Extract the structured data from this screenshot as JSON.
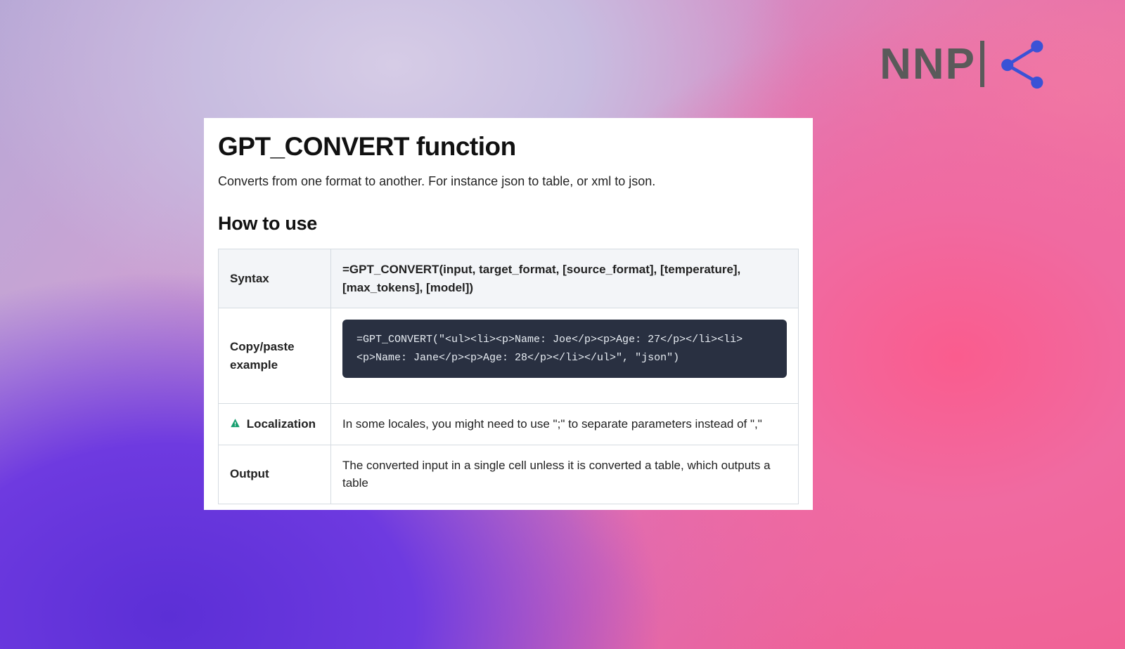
{
  "brand": {
    "text": "NNP"
  },
  "doc": {
    "title": "GPT_CONVERT function",
    "subtitle": "Converts from one format to another. For instance json to table, or xml to json.",
    "section_heading": "How to use",
    "table": {
      "syntax": {
        "label": "Syntax",
        "value": "=GPT_CONVERT(input, target_format, [source_format], [temperature], [max_tokens], [model])"
      },
      "example": {
        "label": "Copy/paste example",
        "code": "=GPT_CONVERT(\"<ul><li><p>Name: Joe</p><p>Age: 27</p></li><li><p>Name: Jane</p><p>Age: 28</p></li></ul>\", \"json\")"
      },
      "localization": {
        "label": "Localization",
        "value": "In some locales, you might need to use \";\" to separate parameters instead of \",\""
      },
      "output": {
        "label": "Output",
        "value": "The converted input in a single cell unless it is converted a table, which outputs a table"
      }
    }
  }
}
